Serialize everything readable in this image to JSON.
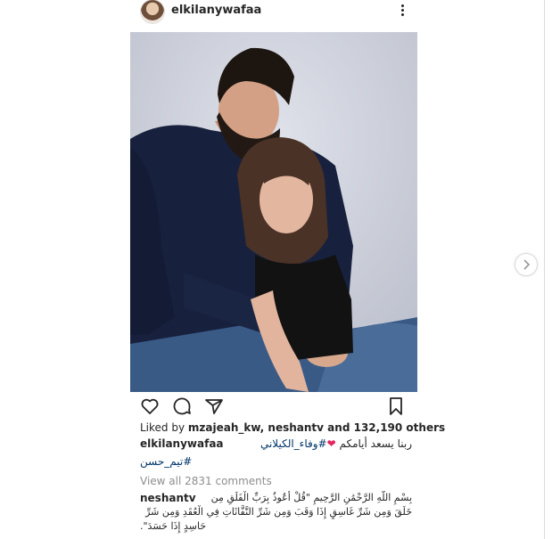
{
  "post": {
    "username": "elkilanywafaa",
    "likes_prefix": "Liked by ",
    "liked_user1": "mzajeah_kw",
    "liked_sep": ", ",
    "liked_user2": "neshantv",
    "likes_and": " and ",
    "likes_count": "132,190 others",
    "caption_user": "elkilanywafaa",
    "caption_text": "ربنا يسعد أيامكم",
    "caption_heart": "❤",
    "caption_tag1": "#وفاء_الكيلاني",
    "caption_tag2": "#تيم_حسن",
    "view_all": "View all 2831 comments",
    "comment_user": "neshantv",
    "comment_line1": "بِسْمِ اللَّهِ الرَّحْمَٰنِ الرَّحِيمِ \"قُلْ أَعُوذُ بِرَبِّ الْفَلَقِ مِن شَرِّ مَا",
    "comment_line2": "خَلَقَ وَمِن شَرِّ غَاسِقٍ إِذَا وَقَبَ وَمِن شَرِّ النَّفَّاثَاتِ فِي الْعُقَدِ وَمِن شَرِّ",
    "comment_line3": "حَاسِدٍ إِذَا حَسَدَ\"."
  },
  "icons": {
    "more": "more-options-icon",
    "like": "heart-icon",
    "comment": "comment-icon",
    "share": "share-icon",
    "save": "bookmark-icon",
    "next": "chevron-right-icon"
  },
  "colors": {
    "text": "#262626",
    "muted": "#8e8e8e",
    "heart": "#e0245e",
    "hashtag": "#003569",
    "border": "#dbdbdb"
  }
}
